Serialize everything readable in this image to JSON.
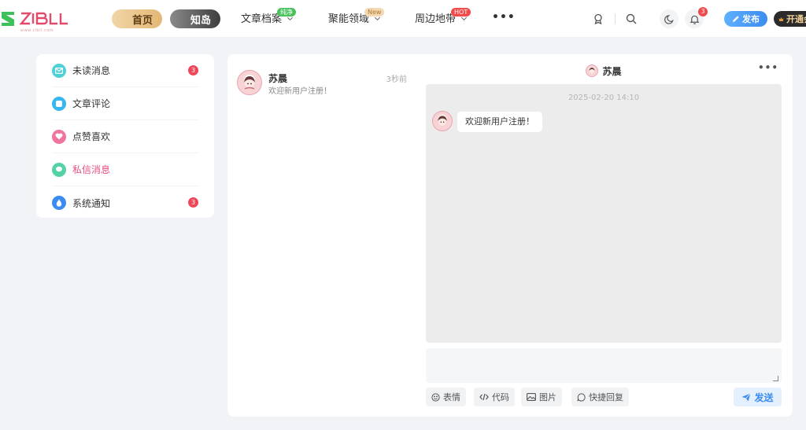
{
  "header": {
    "logo_sub": "www.zibll.com",
    "home_label": "首页",
    "zhi_label": "知岛",
    "nav": [
      {
        "label": "文章档案",
        "badge": "纯净"
      },
      {
        "label": "聚能领域",
        "badge": "New"
      },
      {
        "label": "周边地带",
        "badge": "HOT"
      }
    ],
    "more_label": "•••",
    "notification_count": "3",
    "publish_label": "发布",
    "vip_label": "开通会员"
  },
  "sidebar": {
    "items": [
      {
        "label": "未读消息",
        "icon": "mail-icon",
        "color": "#4fd0d6",
        "badge": "3"
      },
      {
        "label": "文章评论",
        "icon": "comment-icon",
        "color": "#38b6f1",
        "badge": ""
      },
      {
        "label": "点赞喜欢",
        "icon": "heart-icon",
        "color": "#f0759d",
        "badge": ""
      },
      {
        "label": "私信消息",
        "icon": "chat-icon",
        "color": "#55d1a6",
        "badge": ""
      },
      {
        "label": "系统通知",
        "icon": "drop-icon",
        "color": "#3b8cf0",
        "badge": "3"
      }
    ]
  },
  "conversation": {
    "name": "苏晨",
    "time": "3秒前",
    "preview": "欢迎新用户注册！"
  },
  "chat": {
    "title": "苏晨",
    "date": "2025-02-20 14:10",
    "message": "欢迎新用户注册！",
    "tools": {
      "emoji": "表情",
      "code": "代码",
      "image": "图片",
      "quick": "快捷回复"
    },
    "send_label": "发送"
  },
  "colors": {
    "accent": "#3b8cf0",
    "active_pink": "#e84d83",
    "badge_red": "#f04a4a"
  }
}
